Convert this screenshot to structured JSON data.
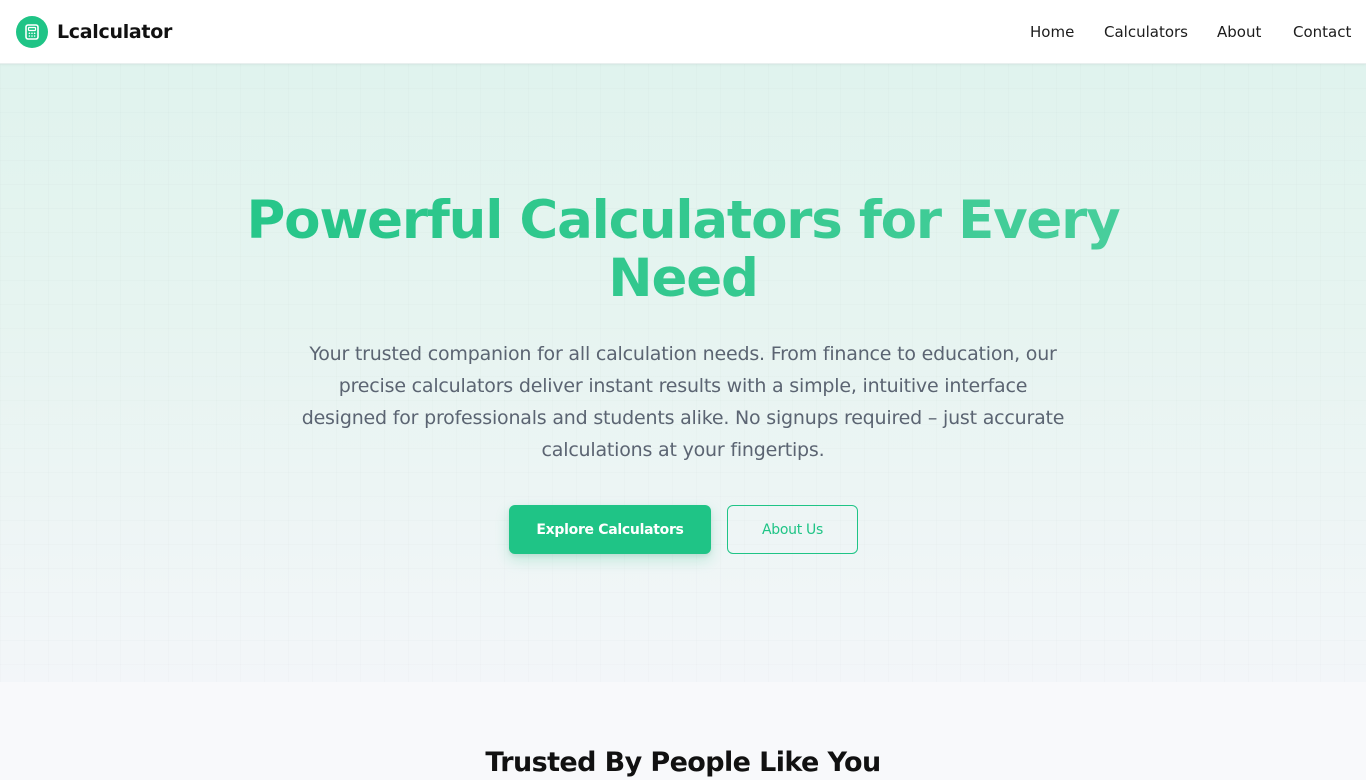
{
  "colors": {
    "brand_green": "#1fc486",
    "text_dark": "#111111",
    "text_muted": "#5b6472",
    "hero_bg_top": "#e0f3ee"
  },
  "header": {
    "brand_icon": "calculator-icon",
    "brand_name": "Lcalculator",
    "nav": [
      {
        "label": "Home"
      },
      {
        "label": "Calculators"
      },
      {
        "label": "About"
      },
      {
        "label": "Contact"
      }
    ]
  },
  "hero": {
    "title_line1": "Powerful Calculators for Every",
    "title_line2": "Need",
    "description": "Your trusted companion for all calculation needs. From finance to education, our precise calculators deliver instant results with a simple, intuitive interface designed for professionals and students alike. No signups required – just accurate calculations at your fingertips.",
    "primary_button": "Explore Calculators",
    "secondary_button": "About Us"
  },
  "trusted": {
    "title": "Trusted By People Like You"
  }
}
